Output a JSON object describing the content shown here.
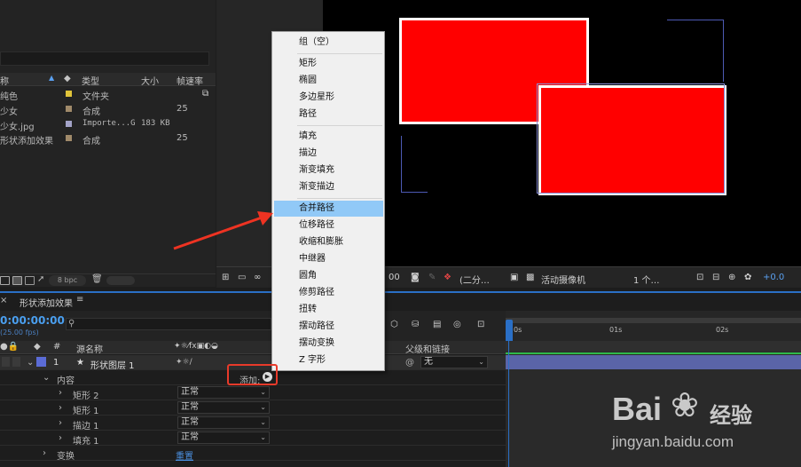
{
  "project": {
    "columns": [
      "称",
      "类型",
      "大小",
      "帧速率"
    ],
    "rows": [
      {
        "name": "纯色",
        "color": "#e0c43a",
        "type": "文件夹",
        "size": "",
        "fps": ""
      },
      {
        "name": "少女",
        "color": "#a08a6a",
        "type": "合成",
        "size": "",
        "fps": "25"
      },
      {
        "name": "少女.jpg",
        "color": "#a3a3c8",
        "type": "Importe...G",
        "size": "183 KB",
        "fps": ""
      },
      {
        "name": "形状添加效果",
        "color": "#a08a6a",
        "type": "合成",
        "size": "",
        "fps": "25"
      }
    ],
    "bpc": "8 bpc"
  },
  "viewer": {
    "timecode": "00",
    "resolution": "(二分…",
    "camera": "活动摄像机",
    "views": "1 个…",
    "exposure": "+0.0"
  },
  "timeline": {
    "comp_name": "形状添加效果",
    "timecode": "0:00:00:00",
    "fps_label": "(25.00 fps)",
    "search_placeholder": "",
    "col_num": "#",
    "col_source": "源名称",
    "col_parent": "父级和链接",
    "layer": {
      "number": "1",
      "name": "形状图层 1",
      "parent": "无",
      "color": "#5b6cd6"
    },
    "contents_label": "内容",
    "add_label": "添加:",
    "children": [
      {
        "name": "矩形 2",
        "mode": "正常"
      },
      {
        "name": "矩形 1",
        "mode": "正常"
      },
      {
        "name": "描边 1",
        "mode": "正常"
      },
      {
        "name": "填充 1",
        "mode": "正常"
      }
    ],
    "transform_label": "变换",
    "reset_label": "重置",
    "ruler_ticks": [
      "0s",
      "01s",
      "02s"
    ]
  },
  "menu": {
    "items_group1": [
      "组（空）"
    ],
    "items_group2": [
      "矩形",
      "椭圆",
      "多边星形",
      "路径"
    ],
    "items_group3": [
      "填充",
      "描边",
      "渐变填充",
      "渐变描边"
    ],
    "items_group4": [
      "合并路径",
      "位移路径",
      "收缩和膨胀",
      "中继器",
      "圆角",
      "修剪路径",
      "扭转",
      "摆动路径",
      "摆动变换",
      "Z 字形"
    ],
    "highlighted": "合并路径"
  },
  "watermark": {
    "brand": "Bai",
    "brand2": "经验",
    "url": "jingyan.baidu.com"
  }
}
